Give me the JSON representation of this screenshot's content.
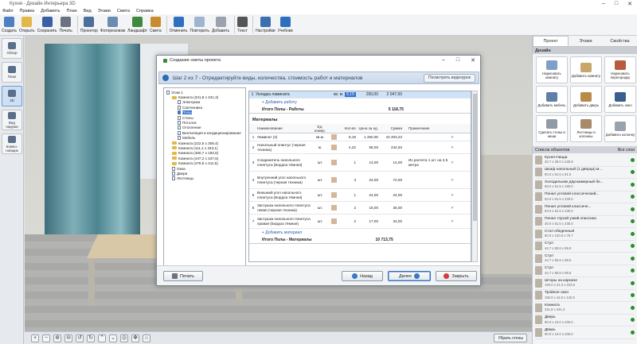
{
  "window": {
    "title": "Кухня - Дизайн Интерьера 3D"
  },
  "menu": [
    "Файл",
    "Правка",
    "Добавить",
    "План",
    "Вид",
    "Этажи",
    "Смета",
    "Справка"
  ],
  "toolbar": [
    {
      "label": "Создать",
      "icon": "new-file-icon",
      "color": "#4d7fc4"
    },
    {
      "label": "Открыть",
      "icon": "folder-icon",
      "color": "#e3b84a"
    },
    {
      "label": "Сохранить",
      "icon": "save-icon",
      "color": "#3b5fa5"
    },
    {
      "label": "Печать",
      "icon": "printer-icon",
      "color": "#6b7280"
    },
    {
      "label": "Проектор",
      "icon": "projector-icon",
      "color": "#4c6f9c"
    },
    {
      "label": "Фотореализм",
      "icon": "photo-icon",
      "color": "#6a8cb3"
    },
    {
      "label": "Ландшафт",
      "icon": "landscape-icon",
      "color": "#3f8a3f"
    },
    {
      "label": "Смета",
      "icon": "estimate-icon",
      "color": "#c98b2c"
    },
    {
      "label": "Отменить",
      "icon": "undo-icon",
      "color": "#2f6fc0"
    },
    {
      "label": "Повторить",
      "icon": "redo-icon",
      "color": "#9fb5cf"
    },
    {
      "label": "Добавить",
      "icon": "add-icon",
      "color": "#9aa3ad"
    },
    {
      "label": "Текст",
      "icon": "text-icon",
      "color": "#555"
    },
    {
      "label": "Настройки",
      "icon": "gear-icon",
      "color": "#3b6fb0"
    },
    {
      "label": "Учебник",
      "icon": "help-icon",
      "color": "#2f6fc0"
    }
  ],
  "leftbar": [
    "Обзор",
    "План",
    "3D",
    "Вид\nнаружи",
    "Компо-\nновщик"
  ],
  "bottom": {
    "hide_walls": "Убрать стены"
  },
  "rightpanel": {
    "tabs": [
      "Проект",
      "Этажи",
      "Свойства"
    ],
    "design_header": "Дизайн",
    "design_items": [
      {
        "label": "Нарисовать комнату",
        "color": "#7da0c8"
      },
      {
        "label": "Добавить комнату",
        "color": "#c8a86a"
      },
      {
        "label": "Нарисовать перегородку",
        "color": "#b85a3c"
      },
      {
        "label": "Добавить мебель",
        "color": "#5f7fa8"
      },
      {
        "label": "Добавить дверь",
        "color": "#b98b4a"
      },
      {
        "label": "Добавить окно",
        "color": "#3a5f8f"
      },
      {
        "label": "Сделать стены и ниши",
        "color": "#8f9aa6"
      },
      {
        "label": "Лестницы и колонны",
        "color": "#a88a6a"
      },
      {
        "label": "Добавить колонну",
        "color": "#9aa3ad"
      }
    ],
    "objects_header": "Список объектов",
    "objects_all": "Все слои",
    "objects": [
      {
        "name": "Кухня Ницца",
        "dim": "20.7 x 28.0 x 225.8"
      },
      {
        "name": "Шкаф напольный (1 дверца) м...",
        "dim": "50.0 x 51.5 x 81.5"
      },
      {
        "name": "Холодильник двухкамерный бе...",
        "dim": "58.0 x 51.5 x 190.0"
      },
      {
        "name": "Пенал угловой классический...",
        "dim": "53.0 x 51.5 x 230.0"
      },
      {
        "name": "Пенал угловой классиче...",
        "dim": "53.0 x 51.5 x 230.0"
      },
      {
        "name": "Пенал глухой узкий классика",
        "dim": "30.0 x 51.5 x 230.0"
      },
      {
        "name": "Стол обеденный",
        "dim": "80.0 x 120.0 x 75.7"
      },
      {
        "name": "Стул",
        "dim": "44.7 x 50.8 x 99.8"
      },
      {
        "name": "Стул",
        "dim": "44.7 x 50.8 x 99.8"
      },
      {
        "name": "Стул",
        "dim": "44.7 x 50.8 x 99.8"
      },
      {
        "name": "Шторы на карнизе",
        "dim": "100.0 x 21.0 x 223.6"
      },
      {
        "name": "Тройное окно",
        "dim": "150.0 x 15.0 x 140.0"
      },
      {
        "name": "Комната",
        "dim": "341.8 x 341.3"
      },
      {
        "name": "Дверь",
        "dim": "90.0 x 10.0 x 200.0"
      },
      {
        "name": "Дверь",
        "dim": "90.0 x 10.0 x 200.0"
      }
    ]
  },
  "dialog": {
    "title": "Создание сметы проекта",
    "step": "Шаг 2 из 7 - Отредактируйте виды, количества, стоимость работ и материалов",
    "video_btn": "Посмотреть видеоурок",
    "tree": [
      {
        "text": "Этаж 1",
        "lvl": 0,
        "t": "pg"
      },
      {
        "text": "Комната (341,8 x 341,3)",
        "lvl": 1,
        "t": "fold"
      },
      {
        "text": "Электрика",
        "lvl": 2,
        "t": "pg"
      },
      {
        "text": "Сантехника",
        "lvl": 2,
        "t": "pg"
      },
      {
        "text": "Полы",
        "lvl": 2,
        "t": "pg",
        "sel": true
      },
      {
        "text": "Стены",
        "lvl": 2,
        "t": "pg"
      },
      {
        "text": "Потолок",
        "lvl": 2,
        "t": "pg"
      },
      {
        "text": "Отопление",
        "lvl": 2,
        "t": "pg"
      },
      {
        "text": "Вентиляция и кондиционирование",
        "lvl": 2,
        "t": "pg"
      },
      {
        "text": "Мебель",
        "lvl": 2,
        "t": "pg"
      },
      {
        "text": "Комната (222,5 x 308,4)",
        "lvl": 1,
        "t": "fold"
      },
      {
        "text": "Комната (111,1 x 343,1)",
        "lvl": 1,
        "t": "fold"
      },
      {
        "text": "Комната (460,7 x 193,5)",
        "lvl": 1,
        "t": "fold"
      },
      {
        "text": "Комната (447,2 x 347,5)",
        "lvl": 1,
        "t": "fold"
      },
      {
        "text": "Комната (478,8 x 411,5)",
        "lvl": 1,
        "t": "fold"
      },
      {
        "text": "Окна",
        "lvl": 1,
        "t": "pg"
      },
      {
        "text": "Двери",
        "lvl": 1,
        "t": "pg"
      },
      {
        "text": "Лестницы",
        "lvl": 1,
        "t": "pg"
      }
    ],
    "works": {
      "row": {
        "n": "1",
        "name": "Укладка ламината",
        "unit": "кв. м.",
        "qty": "8,19",
        "price": "250,00",
        "sum": "2 047,50"
      },
      "add": "+ Добавить работу",
      "total_label": "Итого Полы - Работы",
      "total": "5 118,75"
    },
    "materials": {
      "title": "Материалы",
      "headers": [
        "",
        "Наименование",
        "Ед. измер.",
        "",
        "Кол-во",
        "Цена за ед.",
        "Сумма",
        "Примечание",
        ""
      ],
      "rows": [
        {
          "n": "1",
          "name": "Ламинат (2)",
          "unit": "кв.м.",
          "qty": "8,19",
          "price": "1 250,00",
          "sum": "10 203,22",
          "note": ""
        },
        {
          "n": "2",
          "name": "Напольный плинтус (черная техника)",
          "unit": "м.",
          "qty": "4,22",
          "price": "58,00",
          "sum": "244,53",
          "note": ""
        },
        {
          "n": "3",
          "name": "Соединитель напольного плинтуса (Бордоа тёмная)",
          "unit": "шт.",
          "qty": "1",
          "price": "14,00",
          "sum": "14,00",
          "note": "Из расчета 1 шт. на 2,5 метра"
        },
        {
          "n": "4",
          "name": "Внутренний угол напольного плинтуса (черная техника)",
          "unit": "шт.",
          "qty": "3",
          "price": "24,00",
          "sum": "72,00",
          "note": ""
        },
        {
          "n": "5",
          "name": "Внешний угол напольного плинтуса (Бордоа тёмная)",
          "unit": "шт.",
          "qty": "1",
          "price": "24,00",
          "sum": "24,00",
          "note": ""
        },
        {
          "n": "6",
          "name": "Заглушка напольного плинтуса левая (черная техника)",
          "unit": "шт.",
          "qty": "2",
          "price": "18,00",
          "sum": "36,00",
          "note": ""
        },
        {
          "n": "7",
          "name": "Заглушка напольного плинтуса правая (Бордоа тёмная)",
          "unit": "шт.",
          "qty": "2",
          "price": "17,00",
          "sum": "34,00",
          "note": ""
        }
      ],
      "add": "+ Добавить материал",
      "total_label": "Итого Полы - Материалы",
      "total": "10 713,75"
    },
    "buttons": {
      "print": "Печать",
      "back": "Назад",
      "next": "Далее",
      "close": "Закрыть"
    }
  }
}
